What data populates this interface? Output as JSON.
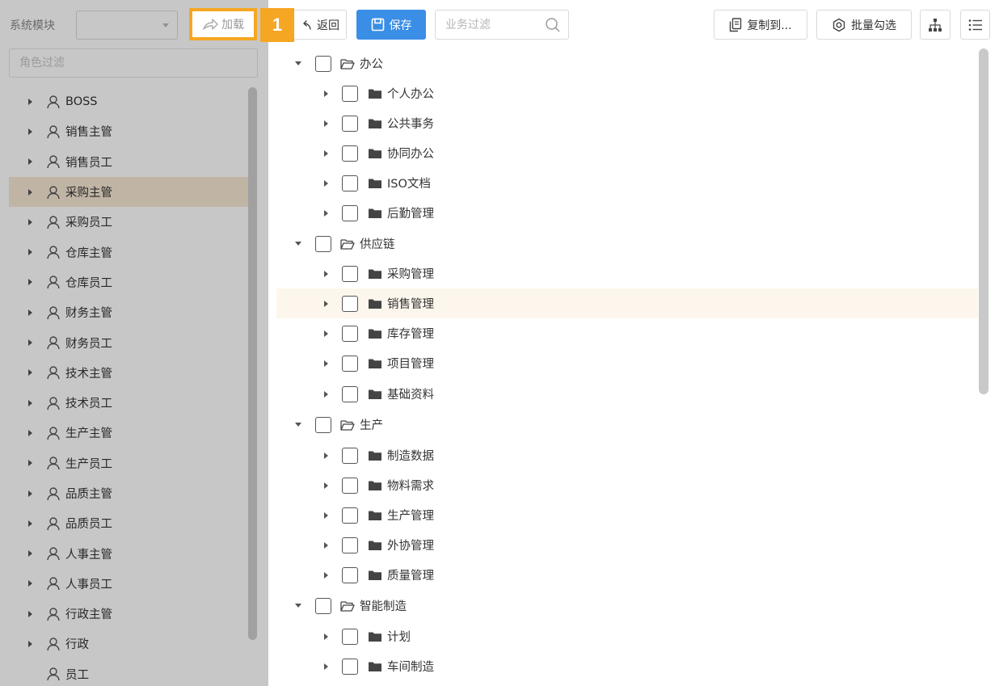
{
  "left_panel": {
    "module_label": "系统模块",
    "module_value": "",
    "load_label": "加载",
    "role_filter_placeholder": "角色过滤",
    "roles": [
      {
        "label": "BOSS",
        "expandable": true,
        "active": false
      },
      {
        "label": "销售主管",
        "expandable": true,
        "active": false
      },
      {
        "label": "销售员工",
        "expandable": true,
        "active": false
      },
      {
        "label": "采购主管",
        "expandable": true,
        "active": true
      },
      {
        "label": "采购员工",
        "expandable": true,
        "active": false
      },
      {
        "label": "仓库主管",
        "expandable": true,
        "active": false
      },
      {
        "label": "仓库员工",
        "expandable": true,
        "active": false
      },
      {
        "label": "财务主管",
        "expandable": true,
        "active": false
      },
      {
        "label": "财务员工",
        "expandable": true,
        "active": false
      },
      {
        "label": "技术主管",
        "expandable": true,
        "active": false
      },
      {
        "label": "技术员工",
        "expandable": true,
        "active": false
      },
      {
        "label": "生产主管",
        "expandable": true,
        "active": false
      },
      {
        "label": "生产员工",
        "expandable": true,
        "active": false
      },
      {
        "label": "品质主管",
        "expandable": true,
        "active": false
      },
      {
        "label": "品质员工",
        "expandable": true,
        "active": false
      },
      {
        "label": "人事主管",
        "expandable": true,
        "active": false
      },
      {
        "label": "人事员工",
        "expandable": true,
        "active": false
      },
      {
        "label": "行政主管",
        "expandable": true,
        "active": false
      },
      {
        "label": "行政",
        "expandable": true,
        "active": false
      },
      {
        "label": "员工",
        "expandable": false,
        "active": false
      }
    ]
  },
  "step_badge": "1",
  "toolbar": {
    "back_label": "返回",
    "save_label": "保存",
    "filter_placeholder": "业务过滤",
    "copy_label": "复制到...",
    "batch_label": "批量勾选"
  },
  "tree": [
    {
      "label": "办公",
      "level": 0
    },
    {
      "label": "个人办公",
      "level": 1
    },
    {
      "label": "公共事务",
      "level": 1
    },
    {
      "label": "协同办公",
      "level": 1
    },
    {
      "label": "ISO文档",
      "level": 1
    },
    {
      "label": "后勤管理",
      "level": 1
    },
    {
      "label": "供应链",
      "level": 0
    },
    {
      "label": "采购管理",
      "level": 1
    },
    {
      "label": "销售管理",
      "level": 1,
      "highlighted": true
    },
    {
      "label": "库存管理",
      "level": 1
    },
    {
      "label": "项目管理",
      "level": 1
    },
    {
      "label": "基础资料",
      "level": 1
    },
    {
      "label": "生产",
      "level": 0
    },
    {
      "label": "制造数据",
      "level": 1
    },
    {
      "label": "物料需求",
      "level": 1
    },
    {
      "label": "生产管理",
      "level": 1
    },
    {
      "label": "外协管理",
      "level": 1
    },
    {
      "label": "质量管理",
      "level": 1
    },
    {
      "label": "智能制造",
      "level": 0
    },
    {
      "label": "计划",
      "level": 1
    },
    {
      "label": "车间制造",
      "level": 1
    }
  ],
  "colors": {
    "accent": "#3a8ee6",
    "highlight_badge": "#f5a623",
    "active_role_bg": "#f6e8d4",
    "hover_row_bg": "#fdf6ec"
  },
  "icons": {
    "role": "user-icon",
    "group_open": "folder-open-icon",
    "group_closed": "folder-icon"
  }
}
